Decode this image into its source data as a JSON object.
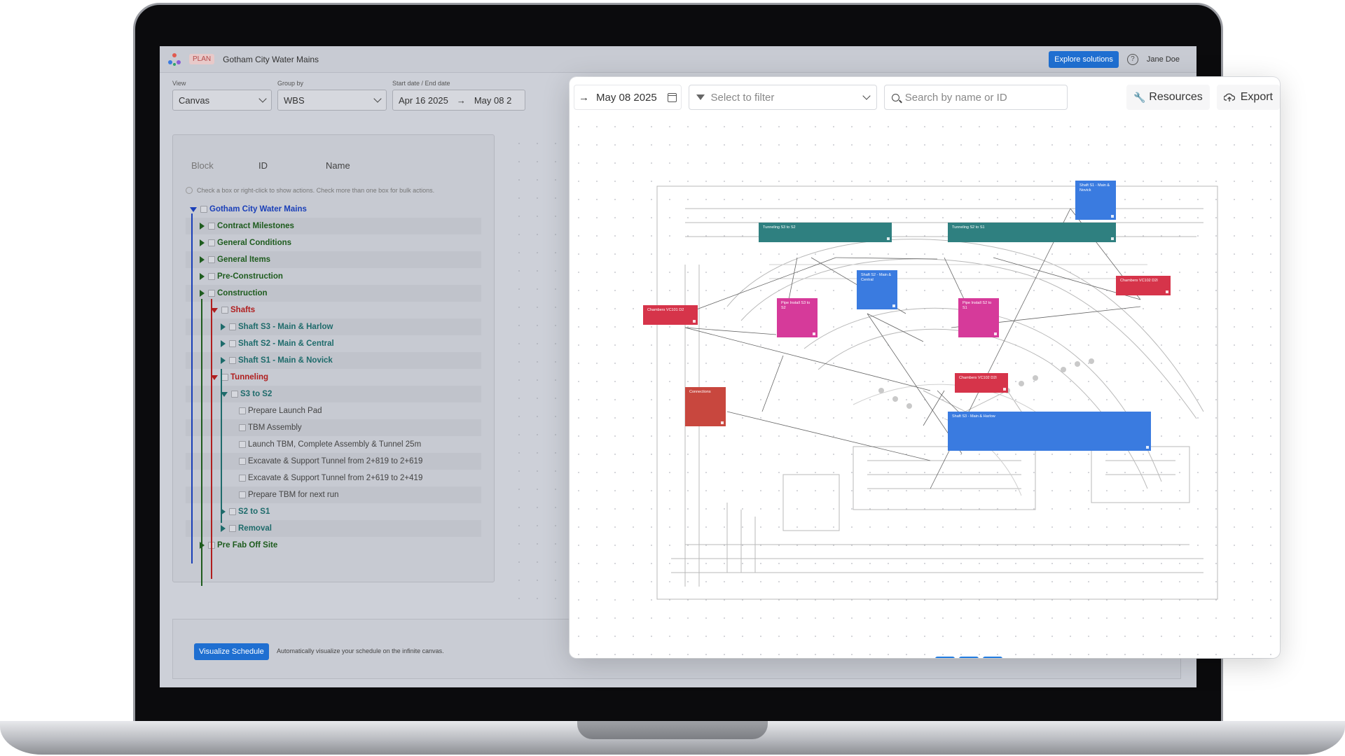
{
  "header": {
    "plan_badge": "PLAN",
    "project_title": "Gotham City Water Mains",
    "explore_button": "Explore solutions",
    "help_icon": "help-circle-icon",
    "user_name": "Jane Doe"
  },
  "controls": {
    "view_label": "View",
    "view_value": "Canvas",
    "group_label": "Group by",
    "group_value": "WBS",
    "date_label": "Start date / End date",
    "start_date": "Apr 16 2025",
    "end_date_truncated": "May 08 2"
  },
  "tree": {
    "columns": [
      "Block",
      "ID",
      "Name"
    ],
    "hint": "Check a box or right-click to show actions. Check more than one box for bulk actions.",
    "rows": [
      {
        "label": "Gotham City Water Mains",
        "level": 0,
        "state": "open",
        "color": "#1a3fb8"
      },
      {
        "label": "Contract Milestones",
        "level": 1,
        "state": "closed",
        "color": "#1e5c1e"
      },
      {
        "label": "General Conditions",
        "level": 1,
        "state": "closed",
        "color": "#1e5c1e"
      },
      {
        "label": "General Items",
        "level": 1,
        "state": "closed",
        "color": "#1e5c1e"
      },
      {
        "label": "Pre-Construction",
        "level": 1,
        "state": "closed",
        "color": "#1e5c1e"
      },
      {
        "label": "Construction",
        "level": 1,
        "state": "closed",
        "color": "#1e5c1e"
      },
      {
        "label": "Shafts",
        "level": 2,
        "state": "open",
        "color": "#b01e1e"
      },
      {
        "label": "Shaft S3 - Main & Harlow",
        "level": 3,
        "state": "closed",
        "color": "#1e6b6b"
      },
      {
        "label": "Shaft S2 - Main & Central",
        "level": 3,
        "state": "closed",
        "color": "#1e6b6b"
      },
      {
        "label": "Shaft S1 - Main & Novick",
        "level": 3,
        "state": "closed",
        "color": "#1e6b6b"
      },
      {
        "label": "Tunneling",
        "level": 2,
        "state": "open",
        "color": "#b01e1e"
      },
      {
        "label": "S3 to S2",
        "level": 3,
        "state": "open",
        "color": "#1e6b6b"
      },
      {
        "label": "Prepare Launch Pad",
        "level": 4,
        "state": "leaf",
        "color": "#444444"
      },
      {
        "label": "TBM Assembly",
        "level": 4,
        "state": "leaf",
        "color": "#444444"
      },
      {
        "label": "Launch TBM, Complete Assembly & Tunnel 25m",
        "level": 4,
        "state": "leaf",
        "color": "#444444"
      },
      {
        "label": "Excavate & Support Tunnel from 2+819 to 2+619",
        "level": 4,
        "state": "leaf",
        "color": "#444444"
      },
      {
        "label": "Excavate & Support Tunnel from 2+619 to 2+419",
        "level": 4,
        "state": "leaf",
        "color": "#444444"
      },
      {
        "label": "Prepare TBM for next run",
        "level": 4,
        "state": "leaf",
        "color": "#444444"
      },
      {
        "label": "S2 to S1",
        "level": 3,
        "state": "closed",
        "color": "#1e6b6b"
      },
      {
        "label": "Removal",
        "level": 3,
        "state": "closed",
        "color": "#1e6b6b"
      },
      {
        "label": "Pre Fab Off Site",
        "level": 1,
        "state": "closed",
        "color": "#1e5c1e"
      }
    ]
  },
  "bottom": {
    "visualize_button": "Visualize Schedule",
    "visualize_text": "Automatically visualize your schedule on the infinite canvas."
  },
  "canvas_window": {
    "date": "May 08 2025",
    "filter_placeholder": "Select to filter",
    "search_placeholder": "Search by name or ID",
    "resources_button": "Resources",
    "export_button": "Export",
    "nodes": [
      {
        "label": "Shaft S1 - Main & Novick",
        "color": "#3a7be0"
      },
      {
        "label": "Tunneling S3 to S2",
        "color": "#2f8080"
      },
      {
        "label": "Tunneling S2 to S1",
        "color": "#2f8080"
      },
      {
        "label": "Shaft S2 - Main & Central",
        "color": "#3a7be0"
      },
      {
        "label": "Chambers VC101 D2",
        "color": "#d6344a"
      },
      {
        "label": "Chambers VC102 D2I",
        "color": "#d6344a"
      },
      {
        "label": "Pipe Install S3 to S2",
        "color": "#d63a9a"
      },
      {
        "label": "Pipe Install S2 to S1",
        "color": "#d63a9a"
      },
      {
        "label": "Chambers VC102 D2I",
        "color": "#d6344a"
      },
      {
        "label": "Connections",
        "color": "#c8473e"
      },
      {
        "label": "Shaft S3 - Main & Harlow",
        "color": "#3a7be0"
      }
    ],
    "zoom_controls": [
      "zoom-out-icon",
      "zoom-in-icon",
      "fit-grid-icon",
      "route-left-icon",
      "route-right-icon",
      "collapse-icon",
      "arrow-up-icon"
    ]
  }
}
